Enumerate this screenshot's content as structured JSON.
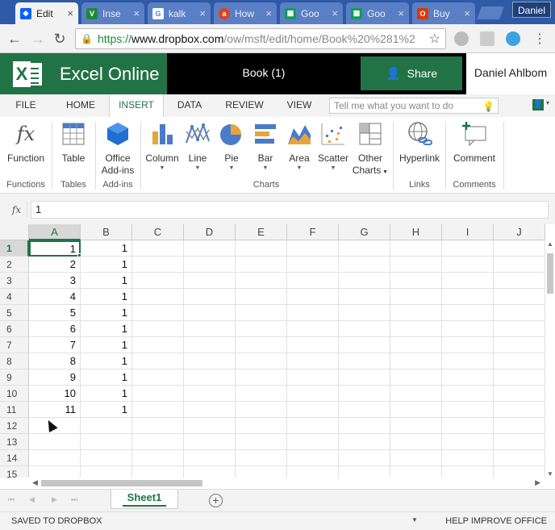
{
  "browser": {
    "tabs": [
      {
        "title": "Edit",
        "icon": "dropbox-icon",
        "color": "#0061fe",
        "active": true
      },
      {
        "title": "Inse",
        "icon": "vim-icon",
        "color": "#1f8a3a",
        "active": false
      },
      {
        "title": "kalk",
        "icon": "google-icon",
        "color": "#ffffff",
        "active": false
      },
      {
        "title": "How",
        "icon": "ask-icon",
        "color": "#e0401c",
        "active": false
      },
      {
        "title": "Goo",
        "icon": "sheets-icon",
        "color": "#0f9d58",
        "active": false
      },
      {
        "title": "Goo",
        "icon": "sheets-icon",
        "color": "#0f9d58",
        "active": false
      },
      {
        "title": "Buy",
        "icon": "office-icon",
        "color": "#d83b01",
        "active": false
      }
    ],
    "profile_name": "Daniel",
    "url_scheme": "https://",
    "url_host": "www.dropbox.com",
    "url_path": "/ow/msft/edit/home/Book%20%281%2"
  },
  "app": {
    "name": "Excel Online",
    "doc_title": "Book (1)",
    "share_label": "Share",
    "user_name": "Daniel Ahlbom",
    "brand_color": "#217346"
  },
  "ribbon_tabs": [
    "FILE",
    "HOME",
    "INSERT",
    "DATA",
    "REVIEW",
    "VIEW"
  ],
  "active_ribbon_tab": "INSERT",
  "tell_me_placeholder": "Tell me what you want to do",
  "ribbon": {
    "function": "Function",
    "table": "Table",
    "addins_line1": "Office",
    "addins_line2": "Add-ins",
    "column": "Column",
    "line": "Line",
    "pie": "Pie",
    "bar": "Bar",
    "area": "Area",
    "scatter": "Scatter",
    "other_line1": "Other",
    "other_line2": "Charts",
    "hyperlink": "Hyperlink",
    "comment": "Comment",
    "groups": {
      "functions": "Functions",
      "tables": "Tables",
      "addins": "Add-ins",
      "charts": "Charts",
      "links": "Links",
      "comments": "Comments"
    }
  },
  "formula_bar": {
    "fx": "fx",
    "value": "1"
  },
  "grid": {
    "columns": [
      "A",
      "B",
      "C",
      "D",
      "E",
      "F",
      "G",
      "H",
      "I",
      "J"
    ],
    "rows": [
      "1",
      "2",
      "3",
      "4",
      "5",
      "6",
      "7",
      "8",
      "9",
      "10",
      "11",
      "12",
      "13",
      "14",
      "15"
    ],
    "col_a": [
      "1",
      "2",
      "3",
      "4",
      "5",
      "6",
      "7",
      "8",
      "9",
      "10",
      "11"
    ],
    "col_b": [
      "1",
      "1",
      "1",
      "1",
      "1",
      "1",
      "1",
      "1",
      "1",
      "1",
      "1"
    ],
    "active_cell": "A1"
  },
  "sheets": [
    "Sheet1"
  ],
  "status": {
    "left": "SAVED TO DROPBOX",
    "right": "HELP IMPROVE OFFICE"
  }
}
